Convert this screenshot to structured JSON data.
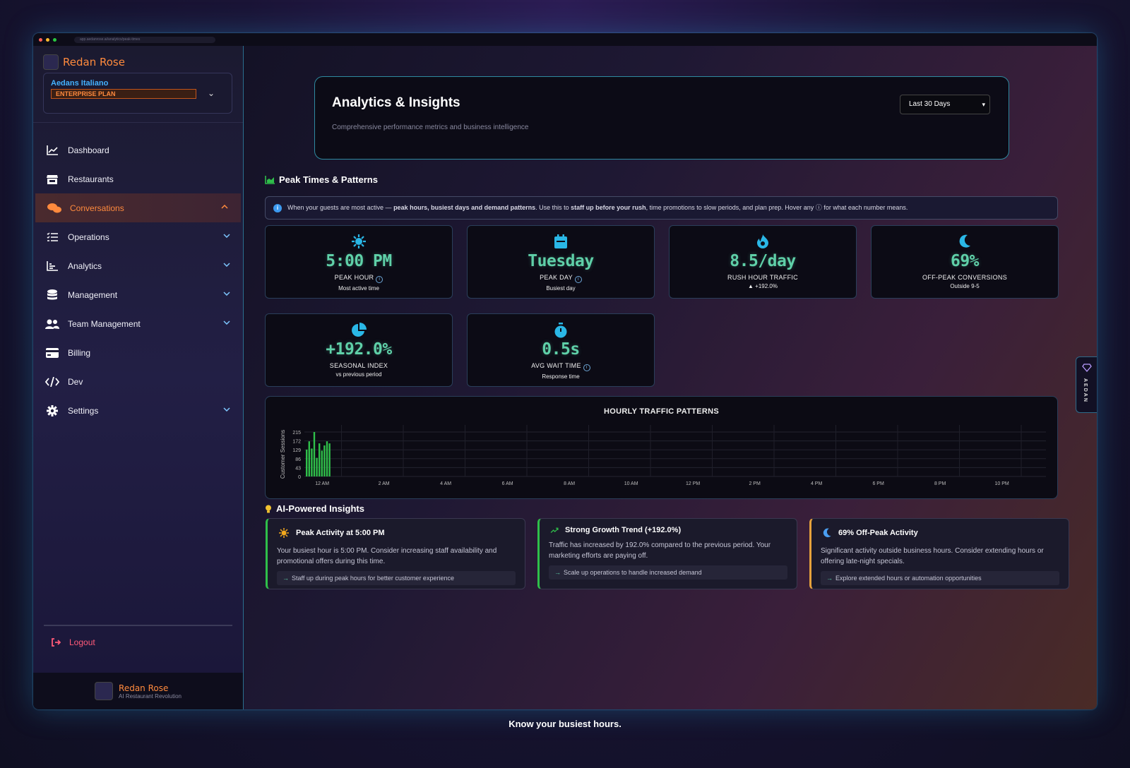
{
  "browser": {
    "url": "app.aedanrose.ai/analytics/peak-times"
  },
  "brand": {
    "name": "Redan Rose",
    "org": "Aedans Italiano",
    "plan": "ENTERPRISE PLAN",
    "footer_name": "Redan Rose",
    "footer_sub": "AI Restaurant Revolution"
  },
  "nav": [
    {
      "label": "Dashboard",
      "icon": "chart-line-icon",
      "chevron": false,
      "active": false
    },
    {
      "label": "Restaurants",
      "icon": "store-icon",
      "chevron": false,
      "active": false
    },
    {
      "label": "Conversations",
      "icon": "chat-bubbles-icon",
      "chevron": "up",
      "active": true
    },
    {
      "label": "Operations",
      "icon": "list-check-icon",
      "chevron": "down",
      "active": false
    },
    {
      "label": "Analytics",
      "icon": "bar-chart-icon",
      "chevron": "down",
      "active": false
    },
    {
      "label": "Management",
      "icon": "database-icon",
      "chevron": "down",
      "active": false
    },
    {
      "label": "Team Management",
      "icon": "users-icon",
      "chevron": "down",
      "active": false
    },
    {
      "label": "Billing",
      "icon": "credit-card-icon",
      "chevron": false,
      "active": false
    },
    {
      "label": "Dev",
      "icon": "code-icon",
      "chevron": false,
      "active": false
    },
    {
      "label": "Settings",
      "icon": "gear-icon",
      "chevron": "down",
      "active": false
    }
  ],
  "logout": "Logout",
  "header": {
    "title": "Analytics & Insights",
    "subtitle": "Comprehensive performance metrics and business intelligence",
    "range": "Last 30 Days"
  },
  "peak": {
    "title": "Peak Times & Patterns",
    "info_parts": [
      "When your guests are most active — ",
      "peak hours, busiest days and demand patterns",
      ". Use this to ",
      "staff up before your rush",
      ", time promotions to slow periods, and plan prep. Hover any ",
      "ⓘ",
      " for what each number means."
    ]
  },
  "stats": [
    {
      "icon": "sun-icon",
      "value": "5:00 PM",
      "label": "PEAK HOUR",
      "info": true,
      "sub": "Most active time"
    },
    {
      "icon": "calendar-icon",
      "value": "Tuesday",
      "label": "PEAK DAY",
      "info": true,
      "sub": "Busiest day"
    },
    {
      "icon": "fire-icon",
      "value": "8.5/day",
      "label": "RUSH HOUR TRAFFIC",
      "info": false,
      "sub": "▲ +192.0%"
    },
    {
      "icon": "moon-icon",
      "value": "69%",
      "label": "OFF-PEAK CONVERSIONS",
      "info": false,
      "sub": "Outside 9-5"
    },
    {
      "icon": "pie-icon",
      "value": "+192.0%",
      "label": "SEASONAL INDEX",
      "info": false,
      "sub": "vs previous period"
    },
    {
      "icon": "stopwatch-icon",
      "value": "0.5s",
      "label": "AVG WAIT TIME",
      "info": true,
      "sub": "Response time"
    }
  ],
  "chart_data": {
    "type": "bar",
    "title": "HOURLY TRAFFIC PATTERNS",
    "ylabel": "Customer Sessions",
    "yticks": [
      0,
      43,
      86,
      129,
      172,
      215
    ],
    "ylim": [
      0,
      215
    ],
    "xticks": [
      "12 AM",
      "2 AM",
      "4 AM",
      "6 AM",
      "8 AM",
      "10 AM",
      "12 PM",
      "2 PM",
      "4 PM",
      "6 PM",
      "8 PM",
      "10 PM"
    ],
    "values": [
      130,
      170,
      135,
      215,
      90,
      160,
      125,
      150,
      170,
      160
    ],
    "color": "#2fbf4a"
  },
  "ai": {
    "title": "AI-Powered Insights",
    "cards": [
      {
        "icon": "sun-icon",
        "accent": "#2fbf4a",
        "title": "Peak Activity at 5:00 PM",
        "body": "Your busiest hour is 5:00 PM. Consider increasing staff availability and promotional offers during this time.",
        "action": "Staff up during peak hours for better customer experience"
      },
      {
        "icon": "trend-up-icon",
        "accent": "#2fbf4a",
        "title": "Strong Growth Trend (+192.0%)",
        "body": "Traffic has increased by 192.0% compared to the previous period. Your marketing efforts are paying off.",
        "action": "Scale up operations to handle increased demand"
      },
      {
        "icon": "moon-icon",
        "accent": "#e6a23c",
        "title": "69% Off-Peak Activity",
        "body": "Significant activity outside business hours. Consider extending hours or offering late-night specials.",
        "action": "Explore extended hours or automation opportunities"
      }
    ]
  },
  "side_tab": "AEDAN",
  "caption": "Know your busiest hours."
}
